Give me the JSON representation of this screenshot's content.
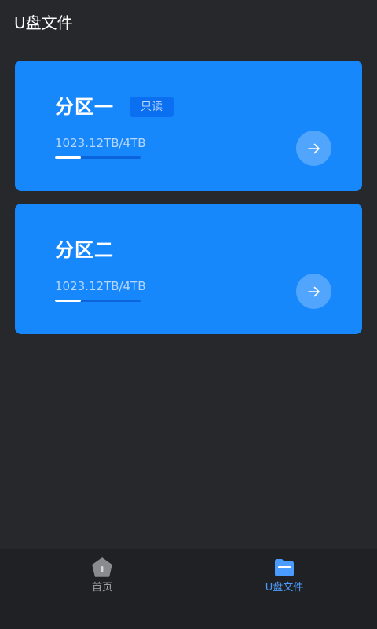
{
  "header": {
    "title": "U盘文件"
  },
  "partitions": [
    {
      "name": "分区一",
      "badge": "只读",
      "usage": "1023.12TB/4TB",
      "progress": 0.3
    },
    {
      "name": "分区二",
      "badge": "",
      "usage": "1023.12TB/4TB",
      "progress": 0.3
    }
  ],
  "tabbar": {
    "home_label": "首页",
    "usb_label": "U盘文件",
    "active_tab": "U盘文件",
    "active_color": "#4b9cff",
    "inactive_color": "#a7a8ac"
  },
  "icons": {
    "arrow": "arrow-right-icon",
    "home": "home-icon",
    "usb": "folder-icon"
  },
  "colors": {
    "background": "#27282c",
    "card": "#1787fc",
    "tabbar": "#202124"
  }
}
